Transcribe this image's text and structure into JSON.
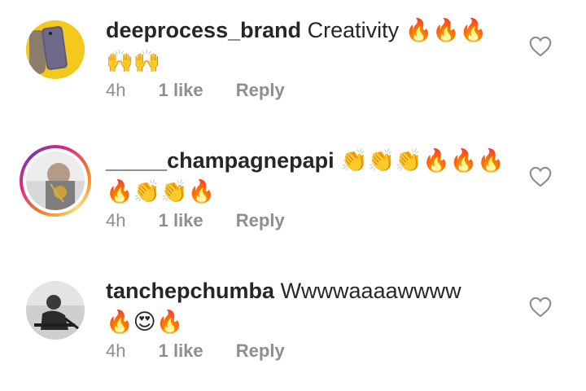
{
  "comments": [
    {
      "username": "deeprocess_brand",
      "text_line1": "Creativity 🔥🔥🔥",
      "text_line2": "🙌🙌",
      "time": "4h",
      "likes": "1 like",
      "reply": "Reply"
    },
    {
      "username": "_____champagnepapi",
      "text_line1": "👏👏👏🔥🔥🔥",
      "text_line2": "🔥👏👏🔥",
      "time": "4h",
      "likes": "1 like",
      "reply": "Reply"
    },
    {
      "username": "tanchepchumba",
      "text_line1": "Wwwwaaaawwww",
      "text_line2": "🔥😍🔥",
      "time": "4h",
      "likes": "1 like",
      "reply": "Reply"
    }
  ],
  "icons": {
    "like": "heart-outline-icon"
  },
  "colors": {
    "text": "#262626",
    "meta": "#8e8e8e",
    "story_ring_start": "#f58529",
    "story_ring_end": "#dd2a7b"
  }
}
